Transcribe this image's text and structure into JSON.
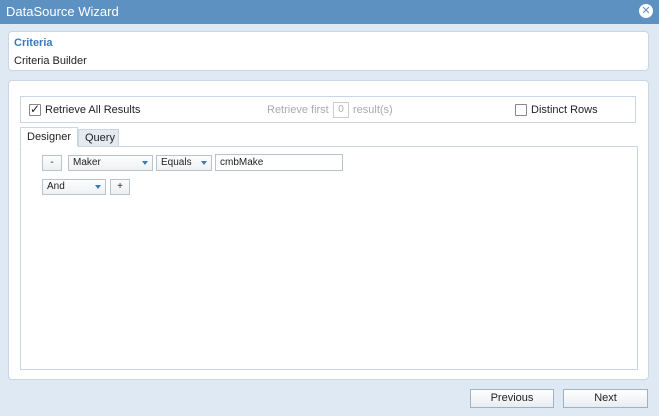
{
  "window": {
    "title": "DataSource Wizard",
    "close_glyph": "✕"
  },
  "criteria": {
    "title": "Criteria",
    "subtitle": "Criteria Builder"
  },
  "options": {
    "retrieve_all_label": "Retrieve All Results",
    "retrieve_all_checked": true,
    "retrieve_first_label": "Retrieve first",
    "retrieve_first_value": "0",
    "results_label": "result(s)",
    "distinct_label": "Distinct Rows",
    "distinct_checked": false
  },
  "tabs": [
    {
      "label": "Designer",
      "active": true
    },
    {
      "label": "Query",
      "active": false
    }
  ],
  "designer": {
    "remove_label": "-",
    "field_value": "Maker",
    "operator_value": "Equals",
    "value_text": "cmbMake",
    "logic_value": "And",
    "add_label": "+"
  },
  "footer": {
    "previous_label": "Previous",
    "next_label": "Next"
  },
  "colors": {
    "titlebar": "#5d91c2",
    "accent": "#3b7ab8",
    "background": "#dfe9f3"
  }
}
